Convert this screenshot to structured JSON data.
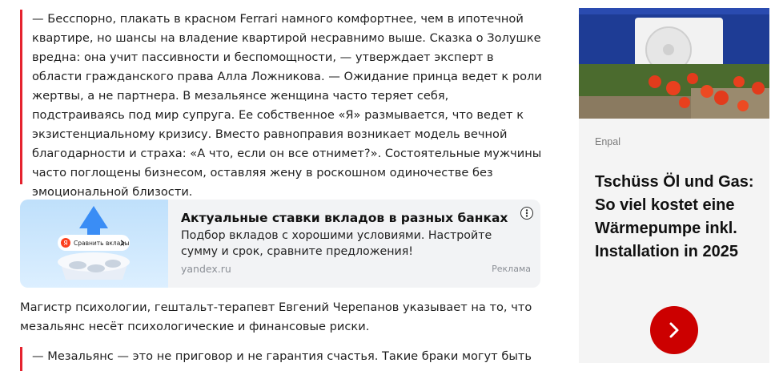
{
  "article": {
    "quote1": "— Бесспорно, плакать в красном Ferrari намного комфортнее, чем в ипотечной квартире, но шансы на владение квартирой несравнимо выше. Сказка о Золушке вредна: она учит пассивности и беспомощности, — утверждает эксперт в области гражданского права Алла Ложникова. — Ожидание принца ведет к роли жертвы, а не партнера. В мезальянсе женщина часто теряет себя, подстраиваясь под мир супруга. Ее собственное «Я» размывается, что ведет к экзистенциальному кризису. Вместо равноправия возникает модель вечной благодарности и страха: «А что, если он все отнимет?». Состоятельные мужчины часто поглощены бизнесом, оставляя жену в роскошном одиночестве без эмоциональной близости.",
    "paragraph": "Магистр психологии, гештальт-терапевт Евгений Черепанов указывает на то, что мезальянс несёт психологические и финансовые риски.",
    "quote2": "— Мезальянс — это не приговор и не гарантия счастья. Такие браки могут быть"
  },
  "ad": {
    "title": "Актуальные ставки вкладов в разных банках",
    "description": "Подбор вкладов с хорошими условиями. Настройте сумму и срок, сравните предложения!",
    "domain": "yandex.ru",
    "label": "Реклама",
    "image_button": "Сравнить вклады",
    "image_badge": "Я",
    "menu_icon": "more-vertical-icon"
  },
  "sidebar_ad": {
    "sponsor": "Enpal",
    "title": "Tschüss Öl und Gas: So viel kostet eine Wärmepumpe inkl. Installation in 2025",
    "cta_icon": "chevron-right-icon",
    "accent": "#cc0000"
  },
  "colors": {
    "quote_border": "#e5232f",
    "ad_background": "#f2f3f5",
    "sidebar_background": "#f4f4f4"
  }
}
